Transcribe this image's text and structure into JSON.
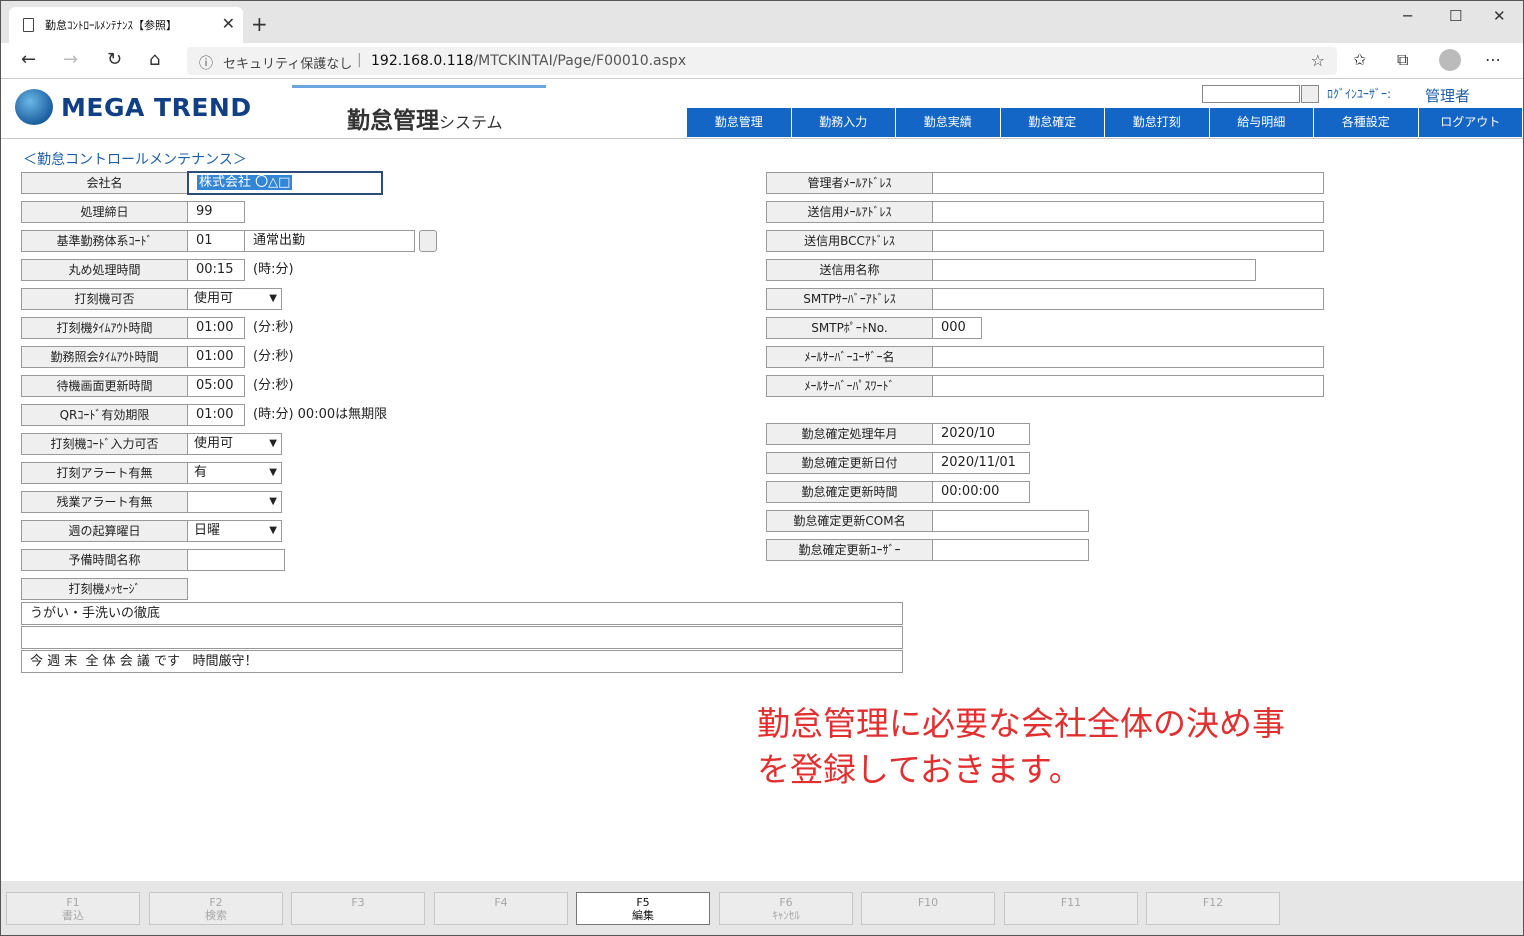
{
  "browser": {
    "tab_title": "勤怠ｺﾝﾄﾛｰﾙﾒﾝﾃﾅﾝｽ【参照】",
    "security": "セキュリティ保護なし",
    "url_host": "192.168.0.118",
    "url_path": "/MTCKINTAI/Page/F00010.aspx"
  },
  "app": {
    "logo": "MEGA TREND",
    "system_title": "勤怠管理",
    "system_suffix": "システム",
    "login_label": "ﾛｸﾞｲﾝﾕｰｻﾞｰ:",
    "login_user": "管理者",
    "menu": [
      "勤怠管理",
      "勤務入力",
      "勤怠実績",
      "勤怠確定",
      "勤怠打刻",
      "給与明細",
      "各種設定",
      "ログアウト"
    ],
    "menu_color": "#1466c6"
  },
  "page": {
    "heading": "＜勤怠コントロールメンテナンス＞"
  },
  "form": {
    "company_label": "会社名",
    "company_value": "株式会社 〇△□",
    "closing_label": "処理締日",
    "closing_value": "99",
    "work_code_label": "基準勤務体系ｺｰﾄﾞ",
    "work_code_value": "01",
    "work_code_name": "通常出勤",
    "rounding_label": "丸め処理時間",
    "rounding_value": "00:15",
    "rounding_unit": "(時:分)",
    "clock_enabled_label": "打刻機可否",
    "clock_enabled_value": "使用可",
    "clock_timeout_label": "打刻機ﾀｲﾑｱｳﾄ時間",
    "clock_timeout_value": "01:00",
    "clock_timeout_unit": "(分:秒)",
    "inquiry_timeout_label": "勤務照会ﾀｲﾑｱｳﾄ時間",
    "inquiry_timeout_value": "01:00",
    "inquiry_timeout_unit": "(分:秒)",
    "standby_refresh_label": "待機画面更新時間",
    "standby_refresh_value": "05:00",
    "standby_refresh_unit": "(分:秒)",
    "qr_expiry_label": "QRｺｰﾄﾞ有効期限",
    "qr_expiry_value": "01:00",
    "qr_expiry_unit": "(時:分) 00:00は無期限",
    "clock_code_input_label": "打刻機ｺｰﾄﾞ入力可否",
    "clock_code_input_value": "使用可",
    "clock_alert_label": "打刻アラート有無",
    "clock_alert_value": "有",
    "overtime_alert_label": "残業アラート有無",
    "overtime_alert_value": "",
    "week_start_label": "週の起算曜日",
    "week_start_value": "日曜",
    "spare_time_label": "予備時間名称",
    "spare_time_value": "",
    "clock_message_label": "打刻機ﾒｯｾｰｼﾞ",
    "messages": [
      "うがい・手洗いの徹底",
      "",
      "今 週 末  全 体 会 議 です   時間厳守！"
    ],
    "admin_mail_label": "管理者ﾒｰﾙｱﾄﾞﾚｽ",
    "admin_mail_value": "",
    "send_mail_label": "送信用ﾒｰﾙｱﾄﾞﾚｽ",
    "send_mail_value": "",
    "send_bcc_label": "送信用BCCｱﾄﾞﾚｽ",
    "send_bcc_value": "",
    "send_name_label": "送信用名称",
    "send_name_value": "",
    "smtp_server_label": "SMTPｻｰﾊﾞｰｱﾄﾞﾚｽ",
    "smtp_server_value": "",
    "smtp_port_label": "SMTPﾎﾟｰﾄNo.",
    "smtp_port_value": "000",
    "mail_user_label": "ﾒｰﾙｻｰﾊﾞｰﾕｰｻﾞｰ名",
    "mail_user_value": "",
    "mail_pass_label": "ﾒｰﾙｻｰﾊﾞｰﾊﾟｽﾜｰﾄﾞ",
    "mail_pass_value": "",
    "confirm_month_label": "勤怠確定処理年月",
    "confirm_month_value": "2020/10",
    "confirm_date_label": "勤怠確定更新日付",
    "confirm_date_value": "2020/11/01",
    "confirm_time_label": "勤怠確定更新時間",
    "confirm_time_value": "00:00:00",
    "confirm_com_label": "勤怠確定更新COM名",
    "confirm_com_value": "",
    "confirm_user_label": "勤怠確定更新ﾕｰｻﾞｰ",
    "confirm_user_value": ""
  },
  "note": {
    "line1": "勤怠管理に必要な会社全体の決め事",
    "line2": "を登録しておきます。",
    "color": "#e23030"
  },
  "fkeys": [
    {
      "key": "F1",
      "label": "書込"
    },
    {
      "key": "F2",
      "label": "検索"
    },
    {
      "key": "F3",
      "label": ""
    },
    {
      "key": "F4",
      "label": ""
    },
    {
      "key": "F5",
      "label": "編集"
    },
    {
      "key": "F6",
      "label": "ｷｬﾝｾﾙ"
    },
    {
      "key": "F10",
      "label": ""
    },
    {
      "key": "F11",
      "label": ""
    },
    {
      "key": "F12",
      "label": ""
    }
  ]
}
